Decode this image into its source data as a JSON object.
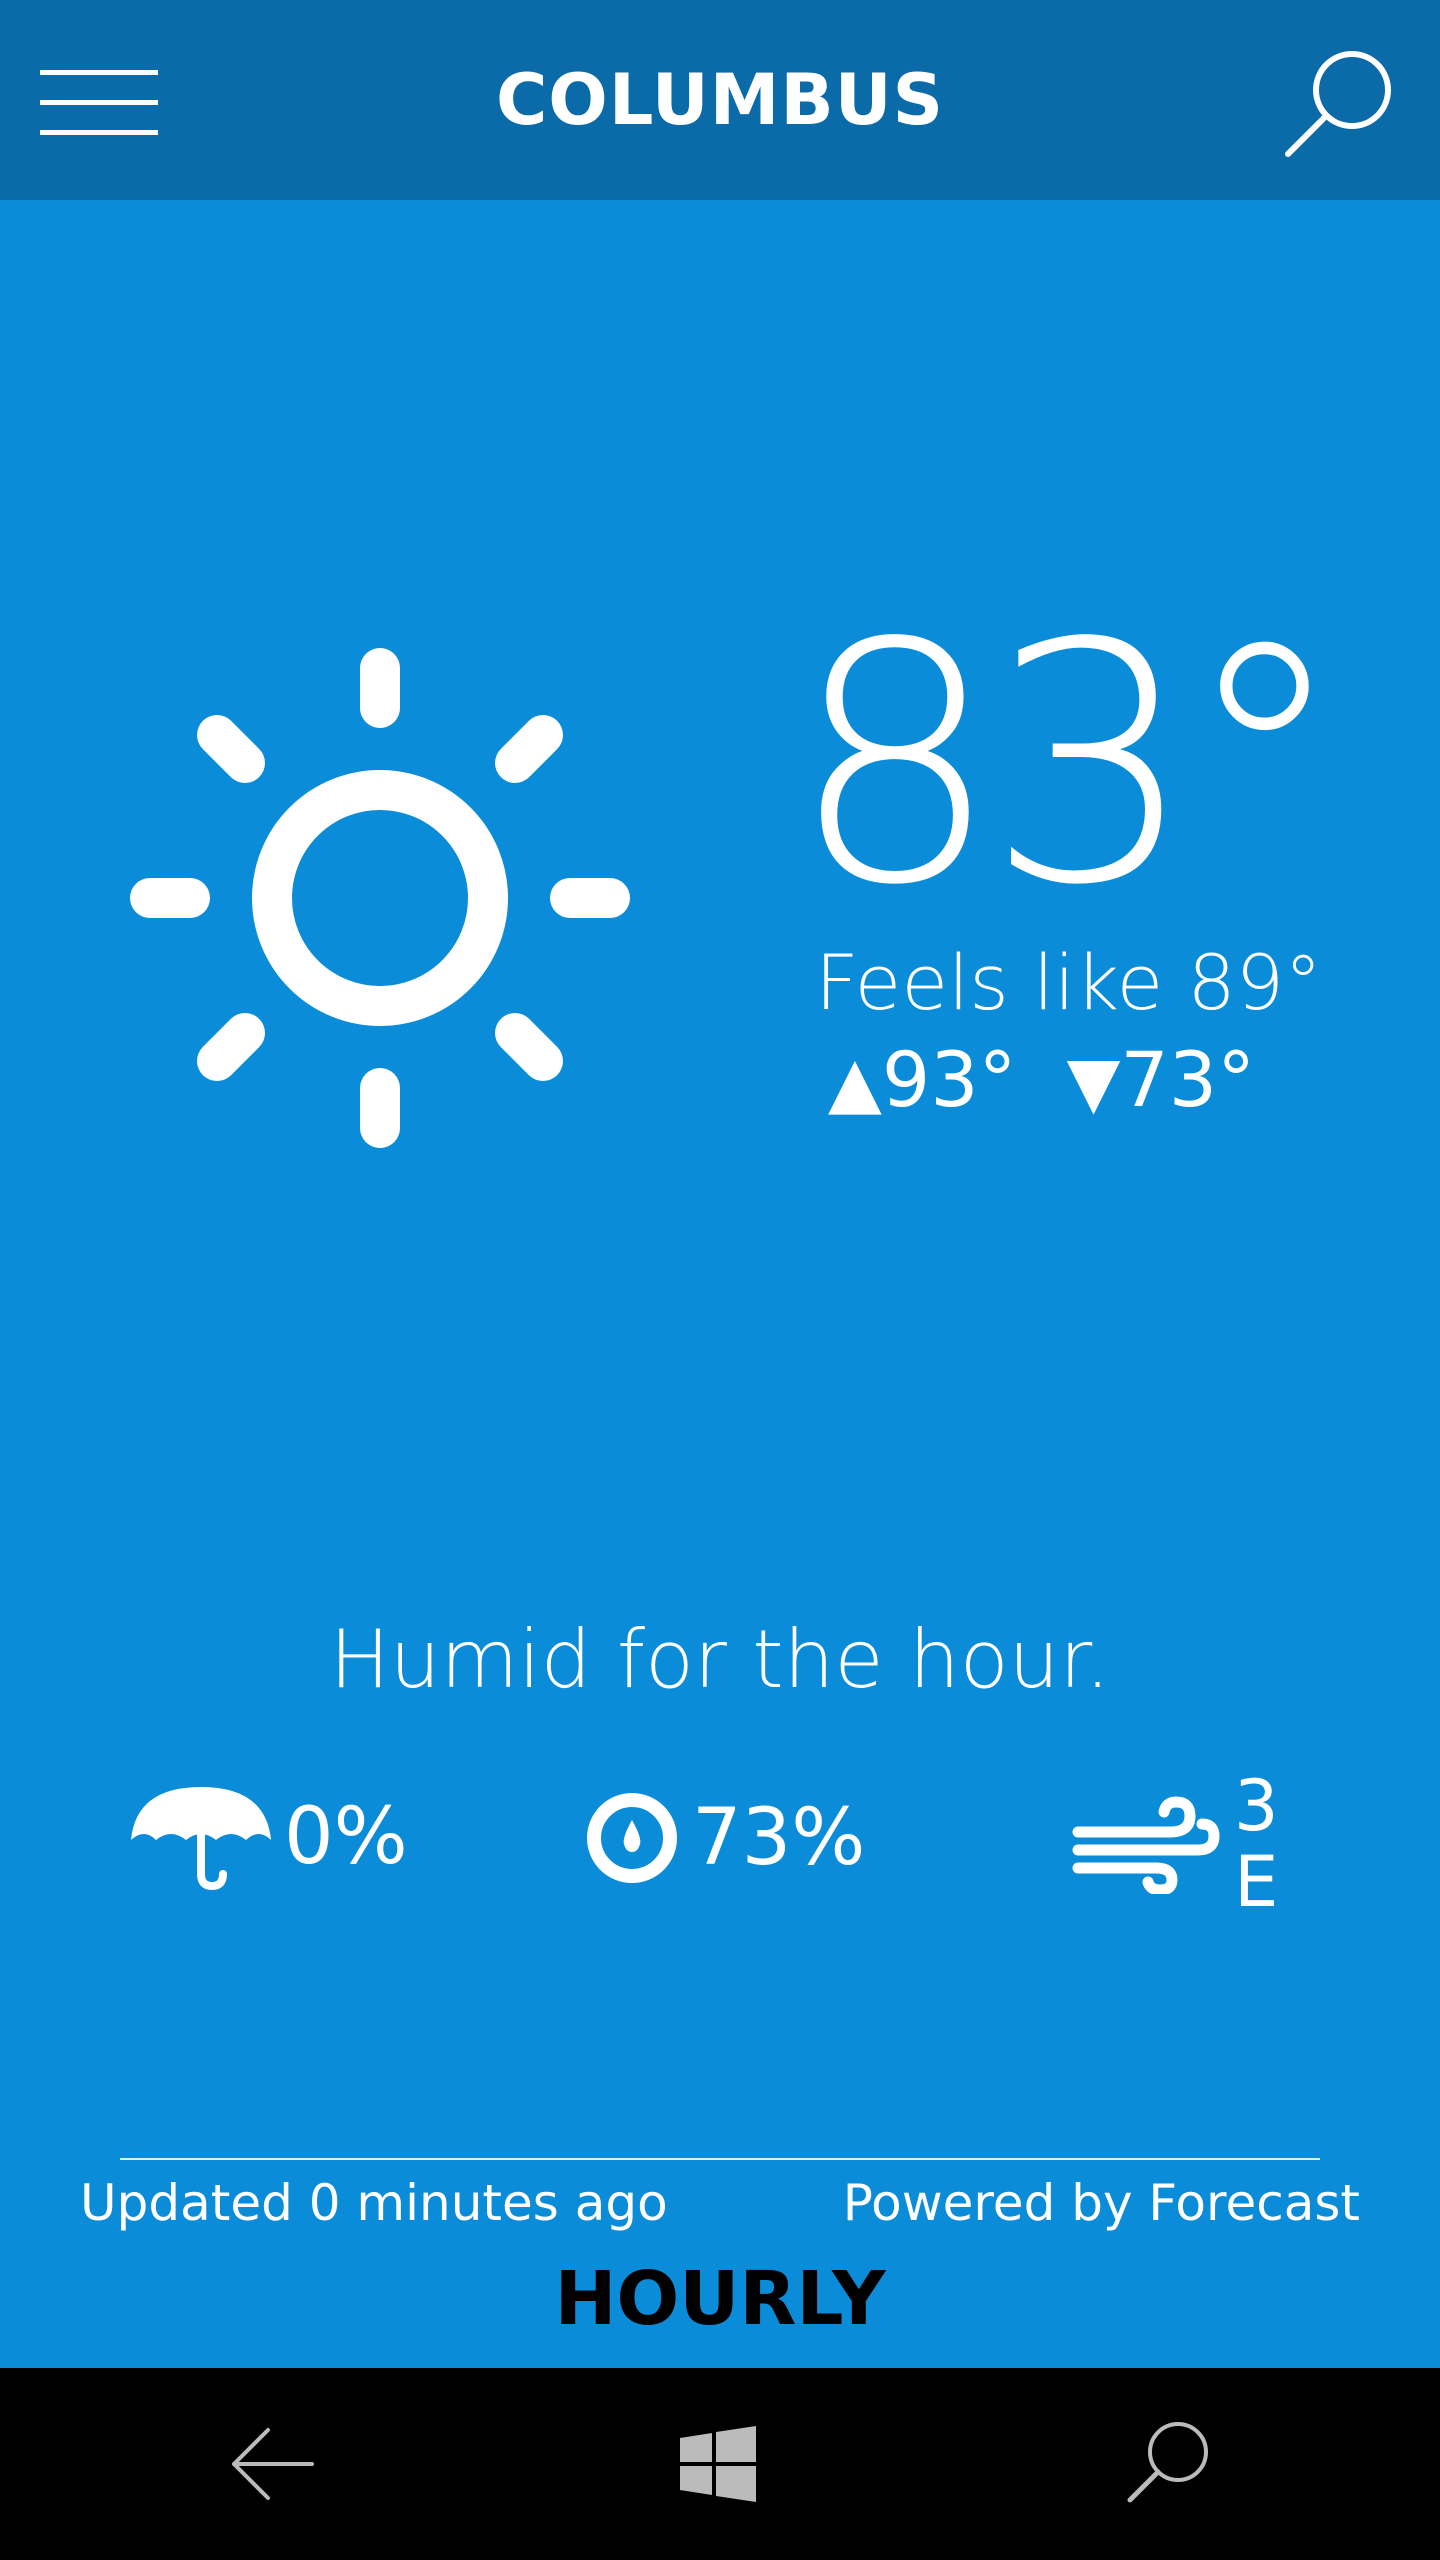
{
  "header": {
    "city": "COLUMBUS",
    "menu_icon": "hamburger-menu-icon",
    "search_icon": "search-icon",
    "background_color": "#0B6AA8"
  },
  "current": {
    "condition_icon": "sun-icon",
    "temperature": "83°",
    "feels_like": "Feels like 89°",
    "high": "93°",
    "low": "73°",
    "high_icon": "triangle-up-icon",
    "low_icon": "triangle-down-icon",
    "summary": "Humid for the hour.",
    "background_color": "#0B8CD8"
  },
  "stats": {
    "precipitation": {
      "icon": "umbrella-icon",
      "value": "0%"
    },
    "humidity": {
      "icon": "humidity-drop-icon",
      "value": "73%"
    },
    "wind": {
      "icon": "wind-icon",
      "speed": "3",
      "direction": "E"
    }
  },
  "footer": {
    "updated": "Updated 0 minutes ago",
    "powered_by": "Powered by Forecast"
  },
  "sections": {
    "hourly_label": "HOURLY"
  },
  "system_nav": {
    "back_icon": "back-arrow-icon",
    "home_icon": "windows-logo-icon",
    "search_icon": "search-icon"
  }
}
